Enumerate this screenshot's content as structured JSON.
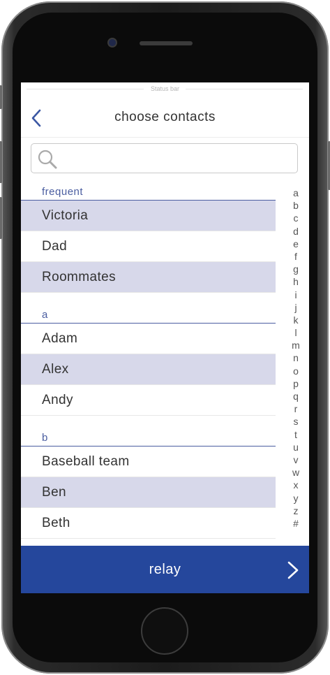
{
  "status_bar": {
    "label": "Status bar"
  },
  "nav": {
    "title": "choose contacts"
  },
  "search": {
    "placeholder": "",
    "value": ""
  },
  "sections": [
    {
      "header": "frequent",
      "contacts": [
        "Victoria",
        "Dad",
        "Roommates"
      ]
    },
    {
      "header": "a",
      "contacts": [
        "Adam",
        "Alex",
        "Andy"
      ]
    },
    {
      "header": "b",
      "contacts": [
        "Baseball team",
        "Ben",
        "Beth"
      ]
    }
  ],
  "index_letters": [
    "a",
    "b",
    "c",
    "d",
    "e",
    "f",
    "g",
    "h",
    "i",
    "j",
    "k",
    "l",
    "m",
    "n",
    "o",
    "p",
    "q",
    "r",
    "s",
    "t",
    "u",
    "v",
    "w",
    "x",
    "y",
    "z",
    "#"
  ],
  "footer": {
    "button_label": "relay"
  },
  "colors": {
    "accent": "#25479c",
    "section_header": "#4a5da0",
    "highlight_row": "#d7d8ea"
  },
  "icons": {
    "back": "chevron-left-icon",
    "search": "search-icon",
    "next": "chevron-right-icon"
  }
}
